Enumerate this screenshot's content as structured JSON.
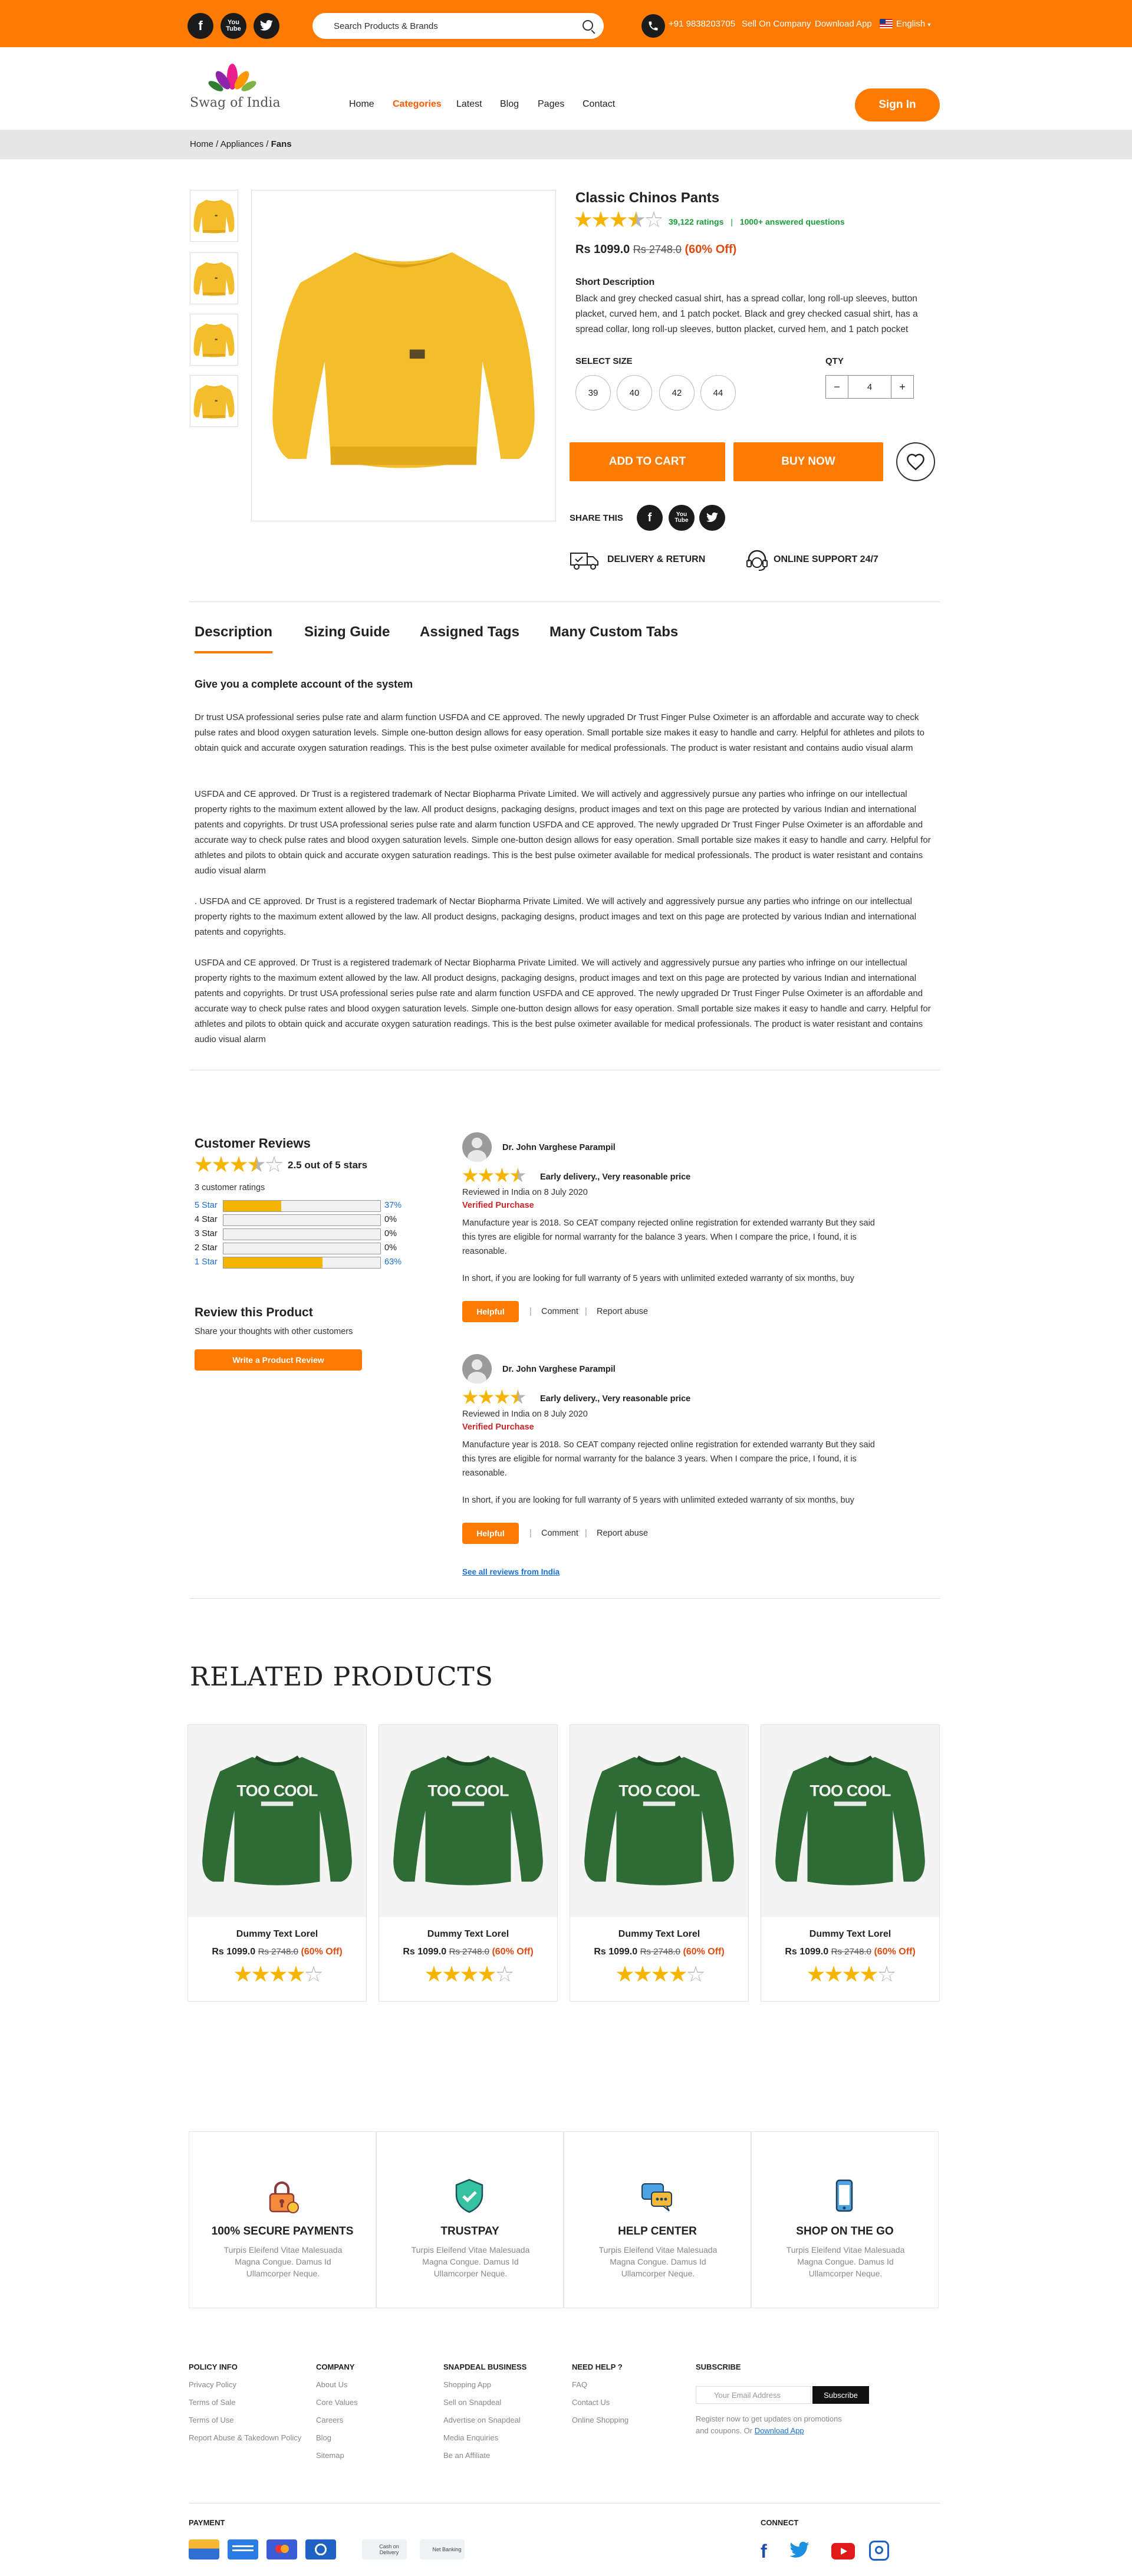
{
  "topbar": {
    "social": [
      "f",
      "You Tube",
      "t"
    ],
    "search_placeholder": "Search Products & Brands",
    "phone": "+91 9838203705",
    "sell": "Sell On Company",
    "download": "Download App",
    "language": "English"
  },
  "header": {
    "logo_text": "Swag of India",
    "nav": [
      "Home",
      "Categories",
      "Latest",
      "Blog",
      "Pages",
      "Contact"
    ],
    "signin": "Sign In"
  },
  "breadcrumb": {
    "parts": [
      "Home",
      "Appliances"
    ],
    "current": "Fans",
    "sep": " / "
  },
  "product": {
    "title": "Classic Chinos Pants",
    "rating": 3.5,
    "ratings_text": "39,122 ratings",
    "answered": "1000+ answered questions",
    "price": "Rs 1099.0",
    "old_price": "Rs 2748.0",
    "discount": "(60% Off)",
    "short_desc_title": "Short Description",
    "short_desc": "Black and grey checked casual shirt, has a spread collar, long roll-up sleeves, button placket, curved hem, and 1 patch pocket. Black and grey checked casual shirt, has a spread collar, long roll-up sleeves, button placket, curved hem, and 1 patch pocket",
    "size_label": "SELECT SIZE",
    "sizes": [
      "39",
      "40",
      "42",
      "44"
    ],
    "qty_label": "QTY",
    "qty": "4",
    "minus": "−",
    "plus": "+",
    "add_to_cart": "ADD TO CART",
    "buy_now": "BUY NOW",
    "share_label": "SHARE THIS",
    "delivery": "DELIVERY & RETURN",
    "support": "ONLINE  SUPPORT 24/7"
  },
  "tabs": [
    "Description",
    "Sizing Guide",
    "Assigned Tags",
    "Many Custom Tabs"
  ],
  "description": {
    "heading": "Give you a complete account of the system",
    "paragraphs": [
      "Dr trust USA professional series pulse rate and alarm function USFDA and CE approved. The newly upgraded Dr Trust Finger Pulse Oximeter is an affordable and accurate way to check pulse rates and blood oxygen saturation levels. Simple one-button design allows for easy operation. Small portable size makes it easy to handle and carry. Helpful for athletes and pilots to obtain quick and accurate oxygen saturation readings. This is the best pulse oximeter available for medical professionals. The product is water resistant and contains audio visual alarm",
      "USFDA and CE approved. Dr Trust is a registered trademark of Nectar Biopharma Private Limited. We will actively and aggressively pursue any parties who infringe on our intellectual property rights to the maximum extent allowed by the law. All product designs, packaging designs, product images and text on this page are protected by various Indian and international patents and copyrights. Dr trust USA professional series pulse rate and alarm function USFDA and CE approved. The newly upgraded Dr Trust Finger Pulse Oximeter is an affordable and accurate way to check pulse rates and blood oxygen saturation levels. Simple one-button design allows for easy operation. Small portable size makes it easy to handle and carry. Helpful for athletes and pilots to obtain quick and accurate oxygen saturation readings. This is the best pulse oximeter available for medical professionals. The product is water resistant and contains audio visual alarm",
      ". USFDA and CE approved. Dr Trust is a registered trademark of Nectar Biopharma Private Limited. We will actively and aggressively pursue any parties who infringe on our intellectual property rights to the maximum extent allowed by the law. All product designs, packaging designs, product images and text on this page are protected by various Indian and international patents and copyrights.",
      "USFDA and CE approved. Dr Trust is a registered trademark of Nectar Biopharma Private Limited. We will actively and aggressively pursue any parties who infringe on our intellectual property rights to the maximum extent allowed by the law. All product designs, packaging designs, product images and text on this page are protected by various Indian and international patents and copyrights. Dr trust USA professional series pulse rate and alarm function USFDA and CE approved. The newly upgraded Dr Trust Finger Pulse Oximeter is an affordable and accurate way to check pulse rates and blood oxygen saturation levels. Simple one-button design allows for easy operation. Small portable size makes it easy to handle and carry. Helpful for athletes and pilots to obtain quick and accurate oxygen saturation readings. This is the best pulse oximeter available for medical professionals. The product is water resistant and contains audio visual alarm"
    ]
  },
  "reviews": {
    "title": "Customer Reviews",
    "average": "2.5 out of 5 stars",
    "count": "3 customer ratings",
    "breakdown": [
      {
        "label": "5 Star",
        "pct": "37%",
        "fill": 0.37
      },
      {
        "label": "4 Star",
        "pct": "0%",
        "fill": 0
      },
      {
        "label": "3 Star",
        "pct": "0%",
        "fill": 0
      },
      {
        "label": "2 Star",
        "pct": "0%",
        "fill": 0
      },
      {
        "label": "1 Star",
        "pct": "63%",
        "fill": 0.63
      }
    ],
    "review_this": "Review this Product",
    "share_thoughts": "Share your thoughts with other customers",
    "write_btn": "Write a Product Review",
    "items": [
      {
        "name": "Dr. John Varghese Parampil",
        "headline": "Early delivery., Very reasonable price",
        "date": "Reviewed in India on 8 July 2020",
        "verified": "Verified Purchase",
        "body": "Manufacture year is 2018. So CEAT company rejected online registration for extended warranty But they said this tyres are eligible for normal warranty for the balance 3 years. When I compare the price, I found, it is reasonable.",
        "body2": "In short, if you are looking for full warranty of 5 years with unlimited exteded warranty of six months, buy",
        "helpful": "Helpful",
        "comment": "Comment",
        "report": "Report abuse"
      },
      {
        "name": "Dr. John Varghese Parampil",
        "headline": "Early delivery., Very reasonable price",
        "date": "Reviewed in India on 8 July 2020",
        "verified": "Verified Purchase",
        "body": "Manufacture year is 2018. So CEAT company rejected online registration for extended warranty But they said this tyres are eligible for normal warranty for the balance 3 years. When I compare the price, I found, it is reasonable.",
        "body2": "In short, if you are looking for full warranty of 5 years with unlimited exteded warranty of six months, buy",
        "helpful": "Helpful",
        "comment": "Comment",
        "report": "Report abuse"
      }
    ],
    "see_all": "See all reviews from India"
  },
  "related": {
    "title": "RELATED PRODUCTS",
    "cards": [
      {
        "name": "Dummy Text Lorel",
        "price": "Rs 1099.0",
        "old": "Rs 2748.0",
        "disc": "(60% Off)",
        "print": "TOO COOL"
      },
      {
        "name": "Dummy Text Lorel",
        "price": "Rs 1099.0",
        "old": "Rs 2748.0",
        "disc": "(60% Off)",
        "print": "TOO COOL"
      },
      {
        "name": "Dummy Text Lorel",
        "price": "Rs 1099.0",
        "old": "Rs 2748.0",
        "disc": "(60% Off)",
        "print": "TOO COOL"
      },
      {
        "name": "Dummy Text Lorel",
        "price": "Rs 1099.0",
        "old": "Rs 2748.0",
        "disc": "(60% Off)",
        "print": "TOO COOL"
      }
    ]
  },
  "features": [
    {
      "title": "100% SECURE PAYMENTS",
      "desc": "Turpis Eleifend Vitae Malesuada Magna Congue. Damus Id Ullamcorper Neque.",
      "icon": "lock-icon"
    },
    {
      "title": "TRUSTPAY",
      "desc": "Turpis Eleifend Vitae Malesuada Magna Congue. Damus Id Ullamcorper Neque.",
      "icon": "shield-check-icon"
    },
    {
      "title": "HELP CENTER",
      "desc": "Turpis Eleifend Vitae Malesuada Magna Congue. Damus Id Ullamcorper Neque.",
      "icon": "chat-icon"
    },
    {
      "title": "SHOP ON THE GO",
      "desc": "Turpis Eleifend Vitae Malesuada Magna Congue. Damus Id Ullamcorper Neque.",
      "icon": "phone-icon"
    }
  ],
  "footer": {
    "cols": [
      {
        "title": "POLICY INFO",
        "links": [
          "Privacy Policy",
          "Terms of Sale",
          "Terms of Use",
          "Report Abuse & Takedown Policy"
        ]
      },
      {
        "title": "COMPANY",
        "links": [
          "About Us",
          "Core Values",
          "Careers",
          "Blog",
          "Sitemap"
        ]
      },
      {
        "title": "SNAPDEAL BUSINESS",
        "links": [
          "Shopping App",
          "Sell on Snapdeal",
          "Advertise on Snapdeal",
          "Media Enquiries",
          "Be an Affiliate"
        ]
      },
      {
        "title": "NEED HELP ?",
        "links": [
          "FAQ",
          "Contact Us",
          "Online Shopping"
        ]
      }
    ],
    "subscribe_title": "SUBSCRIBE",
    "email_placeholder": "Your Email Address",
    "subscribe_btn": "Subscribe",
    "subscribe_note": "Register now to get updates on promotions and coupons. Or",
    "download_link": "Download App",
    "payment_title": "PAYMENT",
    "cod": "Cash on Delivery",
    "netbanking": "Net Banking",
    "connect_title": "CONNECT"
  },
  "colors": {
    "accent": "#ff7a00",
    "star": "#f4b400",
    "green": "#1a9c3a",
    "discount": "#e04a10"
  }
}
